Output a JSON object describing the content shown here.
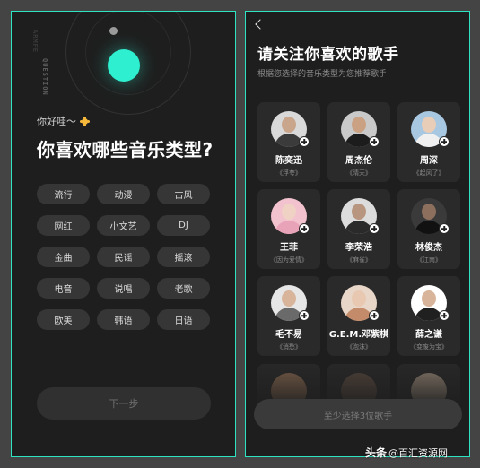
{
  "left": {
    "vertical_text_1": "ARMFE",
    "vertical_text_2": "QUESTION",
    "greeting": "你好哇～",
    "greeting_icon": "sun-icon",
    "title": "你喜欢哪些音乐类型?",
    "genres": [
      "流行",
      "动漫",
      "古风",
      "网红",
      "小文艺",
      "DJ",
      "金曲",
      "民谣",
      "摇滚",
      "电音",
      "说唱",
      "老歌",
      "欧美",
      "韩语",
      "日语"
    ],
    "next_label": "下一步",
    "accent_color": "#2ef0d0"
  },
  "right": {
    "back_icon": "chevron-left-icon",
    "title": "请关注你喜欢的歌手",
    "subtitle": "根据您选择的音乐类型为您推荐歌手",
    "artists": [
      {
        "name": "陈奕迅",
        "song": "《浮夸》",
        "head": "#c9a58c",
        "body": "#3b3b3b",
        "bg": "#d9d9d9"
      },
      {
        "name": "周杰伦",
        "song": "《晴天》",
        "head": "#caa182",
        "body": "#1c1c1c",
        "bg": "#c9c9c9"
      },
      {
        "name": "周深",
        "song": "《起风了》",
        "head": "#e8cdb9",
        "body": "#f0f0f0",
        "bg": "#a8c7e0"
      },
      {
        "name": "王菲",
        "song": "《因为爱情》",
        "head": "#efd2c4",
        "body": "#e9a3b8",
        "bg": "#f3c2cf"
      },
      {
        "name": "李荣浩",
        "song": "《麻雀》",
        "head": "#b8957e",
        "body": "#2a2a2a",
        "bg": "#dcdcdc"
      },
      {
        "name": "林俊杰",
        "song": "《江南》",
        "head": "#8c6f5d",
        "body": "#111111",
        "bg": "#3a3a3a"
      },
      {
        "name": "毛不易",
        "song": "《消愁》",
        "head": "#d8b49b",
        "body": "#6a6a6a",
        "bg": "#e6e6e6"
      },
      {
        "name": "G.E.M.邓紫棋",
        "song": "《泡沫》",
        "head": "#e8c8b0",
        "body": "#c48b6a",
        "bg": "#e8d7c8"
      },
      {
        "name": "薛之谦",
        "song": "《变废为宝》",
        "head": "#d7b49a",
        "body": "#202020",
        "bg": "#ffffff"
      }
    ],
    "partial_avatars": [
      "#8a6a52",
      "#5a4a40",
      "#9a8a7a"
    ],
    "select_label": "至少选择3位歌手"
  },
  "watermark": {
    "brand": "头条",
    "account": "@百汇资源网"
  }
}
